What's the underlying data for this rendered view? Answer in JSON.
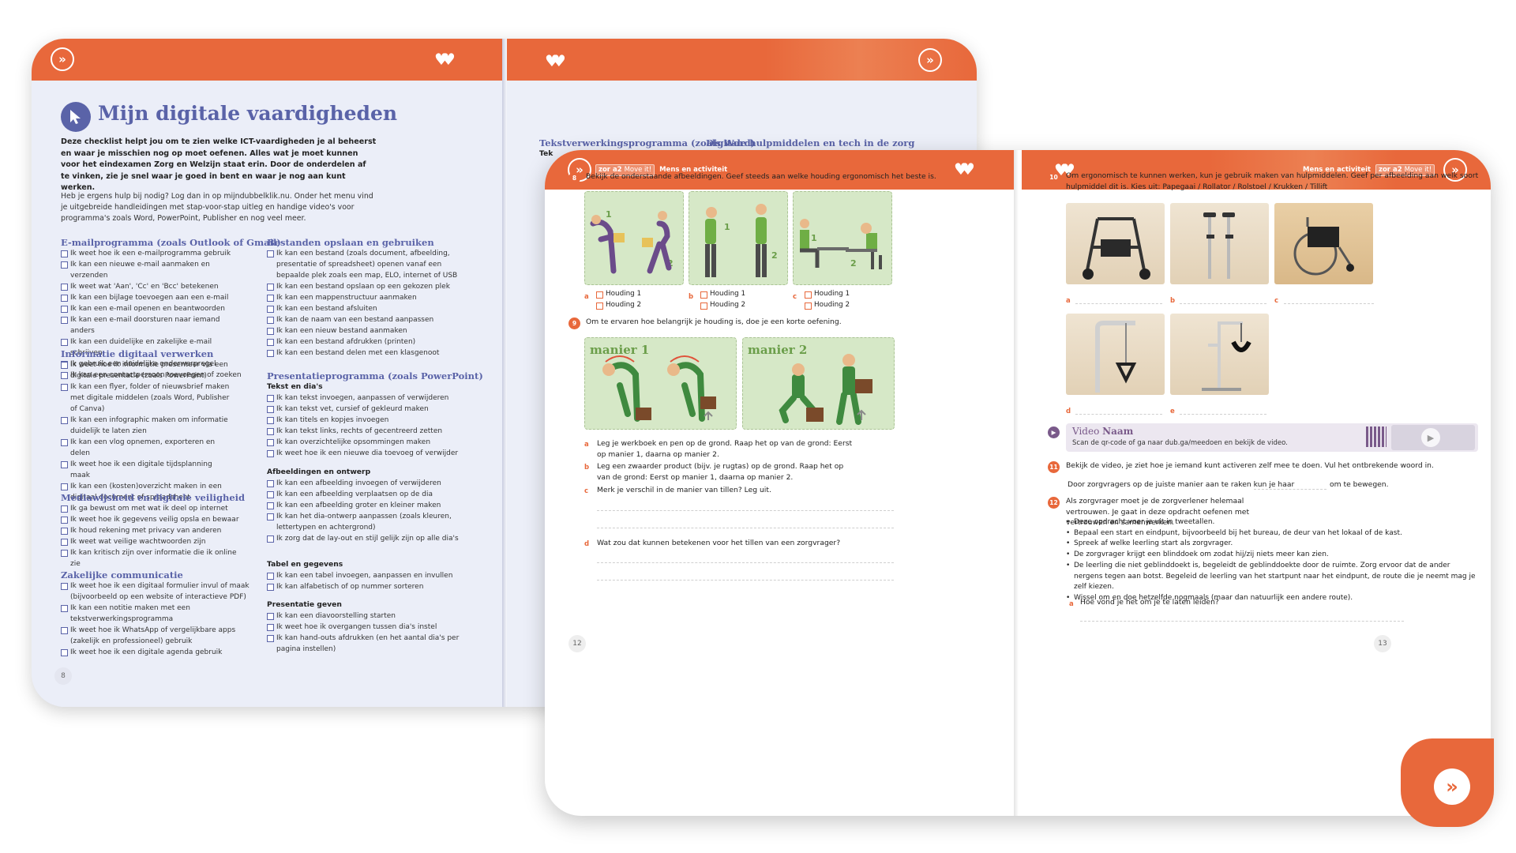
{
  "back_left": {
    "title": "Mijn digitale vaardigheden",
    "intro": "Deze checklist helpt jou om te zien welke ICT-vaardigheden je al beheerst en waar je misschien nog op moet oefenen. Alles wat je moet kunnen voor het eindexamen Zorg en Welzijn staat erin. Door de onderdelen af te vinken, zie je snel waar je goed in bent en waar je nog aan kunt werken.",
    "help": "Heb je ergens hulp bij nodig? Log dan in op mijndubbelklik.nu. Onder het menu vind je uitgebreide handleidingen met stap-voor-stap uitleg en handige video's voor programma's zoals Word, PowerPoint, Publisher en nog veel meer.",
    "page_number": "8",
    "sections": [
      {
        "title": "E-mailprogramma (zoals Outlook of Gmail)",
        "items": [
          "Ik weet hoe ik een e-mailprogramma gebruik",
          "Ik kan een nieuwe e-mail aanmaken en verzenden",
          "Ik weet wat 'Aan', 'Cc' en 'Bcc' betekenen",
          "Ik kan een bijlage toevoegen aan een e-mail",
          "Ik kan een e-mail openen en beantwoorden",
          "Ik kan een e-mail doorsturen naar iemand anders",
          "Ik kan een duidelijke en zakelijke e-mail schrijven",
          "Ik gebruik een duidelijke onderwerpregel",
          "Ik kan een contactpersoon toevoegen of zoeken"
        ]
      },
      {
        "title": "Informatie digitaal verwerken",
        "items": [
          "Ik weet hoe ik informatie presenteer via een digitale presentatie (zoals PowerPoint)",
          "Ik kan een flyer, folder of nieuwsbrief maken met digitale middelen (zoals Word, Publisher of Canva)",
          "Ik kan een infographic maken om informatie duidelijk te laten zien",
          "Ik kan een vlog opnemen, exporteren en delen",
          "Ik weet hoe ik een digitale tijdsplanning maak",
          "Ik kan een (kosten)overzicht maken in een digitaal document of spreadsheet"
        ]
      },
      {
        "title": "Mediawijsheid en digitale veiligheid",
        "items": [
          "Ik ga bewust om met wat ik deel op internet",
          "Ik weet hoe ik gegevens veilig opsla en bewaar",
          "Ik houd rekening met privacy van anderen",
          "Ik weet wat veilige wachtwoorden zijn",
          "Ik kan kritisch zijn over informatie die ik online zie"
        ]
      },
      {
        "title": "Zakelijke communicatie",
        "items": [
          "Ik weet hoe ik een digitaal formulier invul of maak (bijvoorbeeld op een website of interactieve PDF)",
          "Ik kan een notitie maken met een tekstverwerkingsprogramma",
          "Ik weet hoe ik WhatsApp of vergelijkbare apps (zakelijk en professioneel) gebruik",
          "Ik weet hoe ik een digitale agenda gebruik"
        ]
      }
    ],
    "sections_right": [
      {
        "title": "Bestanden opslaan en gebruiken",
        "items": [
          "Ik kan een bestand (zoals document, afbeelding, presentatie of spreadsheet) openen vanaf een bepaalde plek zoals een map, ELO, internet of USB",
          "Ik kan een bestand opslaan op een gekozen plek",
          "Ik kan een mappenstructuur aanmaken",
          "Ik kan een bestand afsluiten",
          "Ik kan de naam van een bestand aanpassen",
          "Ik kan een nieuw bestand aanmaken",
          "Ik kan een bestand afdrukken (printen)",
          "Ik kan een bestand delen met een klasgenoot"
        ]
      },
      {
        "title": "Presentatieprogramma (zoals PowerPoint)",
        "subtitle": "Tekst en dia's",
        "items": [
          "Ik kan tekst invoegen, aanpassen of verwijderen",
          "Ik kan tekst vet, cursief of gekleurd maken",
          "Ik kan titels en kopjes invoegen",
          "Ik kan tekst links, rechts of gecentreerd zetten",
          "Ik kan overzichtelijke opsommingen maken",
          "Ik weet hoe ik een nieuwe dia toevoeg of verwijder"
        ]
      },
      {
        "subtitle": "Afbeeldingen en ontwerp",
        "items": [
          "Ik kan een afbeelding invoegen of verwijderen",
          "Ik kan een afbeelding verplaatsen op de dia",
          "Ik kan een afbeelding groter en kleiner maken",
          "Ik kan het dia-ontwerp aanpassen (zoals kleuren, lettertypen en achtergrond)",
          "Ik zorg dat de lay-out en stijl gelijk zijn op alle dia's"
        ]
      },
      {
        "subtitle": "Tabel en gegevens",
        "items": [
          "Ik kan een tabel invoegen, aanpassen en invullen",
          "Ik kan alfabetisch of op nummer sorteren"
        ]
      },
      {
        "subtitle": "Presentatie geven",
        "items": [
          "Ik kan een diavoorstelling starten",
          "Ik weet hoe ik overgangen tussen dia's instel",
          "Ik kan hand-outs afdrukken (en het aantal dia's per pagina instellen)"
        ]
      }
    ]
  },
  "back_right": {
    "heading_1": "Tekstverwerkingsprogramma (zoals Word)",
    "heading_2": "Digitale hulpmiddelen en tech in de zorg",
    "partial": "Tek"
  },
  "front_left": {
    "header": {
      "brand": "zor a2",
      "badge": "Move it!",
      "section": "Mens en activiteit"
    },
    "page_number": "12",
    "q8": {
      "num": "8",
      "text": "Bekijk de onderstaande afbeeldingen. Geef steeds aan welke houding ergonomisch het beste is.",
      "options": [
        {
          "letter": "a",
          "h1": "Houding 1",
          "h2": "Houding 2"
        },
        {
          "letter": "b",
          "h1": "Houding 1",
          "h2": "Houding 2"
        },
        {
          "letter": "c",
          "h1": "Houding 1",
          "h2": "Houding 2"
        }
      ]
    },
    "q9": {
      "num": "9",
      "text": "Om te ervaren hoe belangrijk je houding is, doe je een korte oefening.",
      "manier1": "manier 1",
      "manier2": "manier 2",
      "a": "Leg je werkboek en pen op de grond. Raap het op van de grond: Eerst op manier 1, daarna op manier 2.",
      "b": "Leg een zwaarder product (bijv. je rugtas) op de grond. Raap het op van de grond: Eerst op manier 1, daarna op manier 2.",
      "c": "Merk je verschil in de manier van tillen? Leg uit.",
      "d": "Wat zou dat kunnen betekenen voor het tillen van een zorgvrager?"
    }
  },
  "front_right": {
    "header": {
      "section": "Mens en activiteit",
      "brand": "zor a2",
      "badge": "Move it!"
    },
    "page_number": "13",
    "q10": {
      "num": "10",
      "text": "Om ergonomisch te kunnen werken, kun je gebruik maken van hulpmiddelen. Geef per afbeelding aan welk soort hulpmiddel dit is. Kies uit: Papegaai / Rollator / Rolstoel / Krukken / Tillift",
      "labels": [
        "a",
        "b",
        "c",
        "d",
        "e"
      ]
    },
    "video": {
      "title": "Video",
      "title_bold": "Naam",
      "text": "Scan de qr-code of ga naar dub.ga/meedoen en bekijk de video."
    },
    "q11": {
      "num": "11",
      "text": "Bekijk de video, je ziet hoe je iemand kunt activeren zelf mee te doen. Vul het ontbrekende woord in.",
      "fill_a": "Door zorgvragers op de juiste manier aan te raken kun je haar",
      "fill_b": "om te bewegen."
    },
    "q12": {
      "num": "12",
      "text": "Als zorgvrager moet je de zorgverlener helemaal vertrouwen. Je gaat in deze opdracht oefenen met vertrouwen en samenwerken.",
      "bullets": [
        "Deze opdracht voer je uit in tweetallen.",
        "Bepaal een start en eindpunt, bijvoorbeeld bij het bureau, de deur van het lokaal of de kast.",
        "Spreek af welke leerling start als zorgvrager.",
        "De zorgvrager krijgt een blinddoek om zodat hij/zij niets meer kan zien.",
        "De leerling die niet geblinddoekt is, begeleidt de geblinddoekte door de ruimte. Zorg ervoor dat de ander nergens tegen aan botst. Begeleid de leerling van het startpunt naar het eindpunt, de route die je neemt mag je zelf kiezen.",
        "Wissel om en doe hetzelfde nogmaals (maar dan natuurlijk een andere route)."
      ],
      "a": "Hoe vond je het om je te laten leiden?"
    }
  },
  "colors": {
    "accent": "#e8683b",
    "heading": "#5a63a8",
    "illustration": "#d6e8c7"
  }
}
